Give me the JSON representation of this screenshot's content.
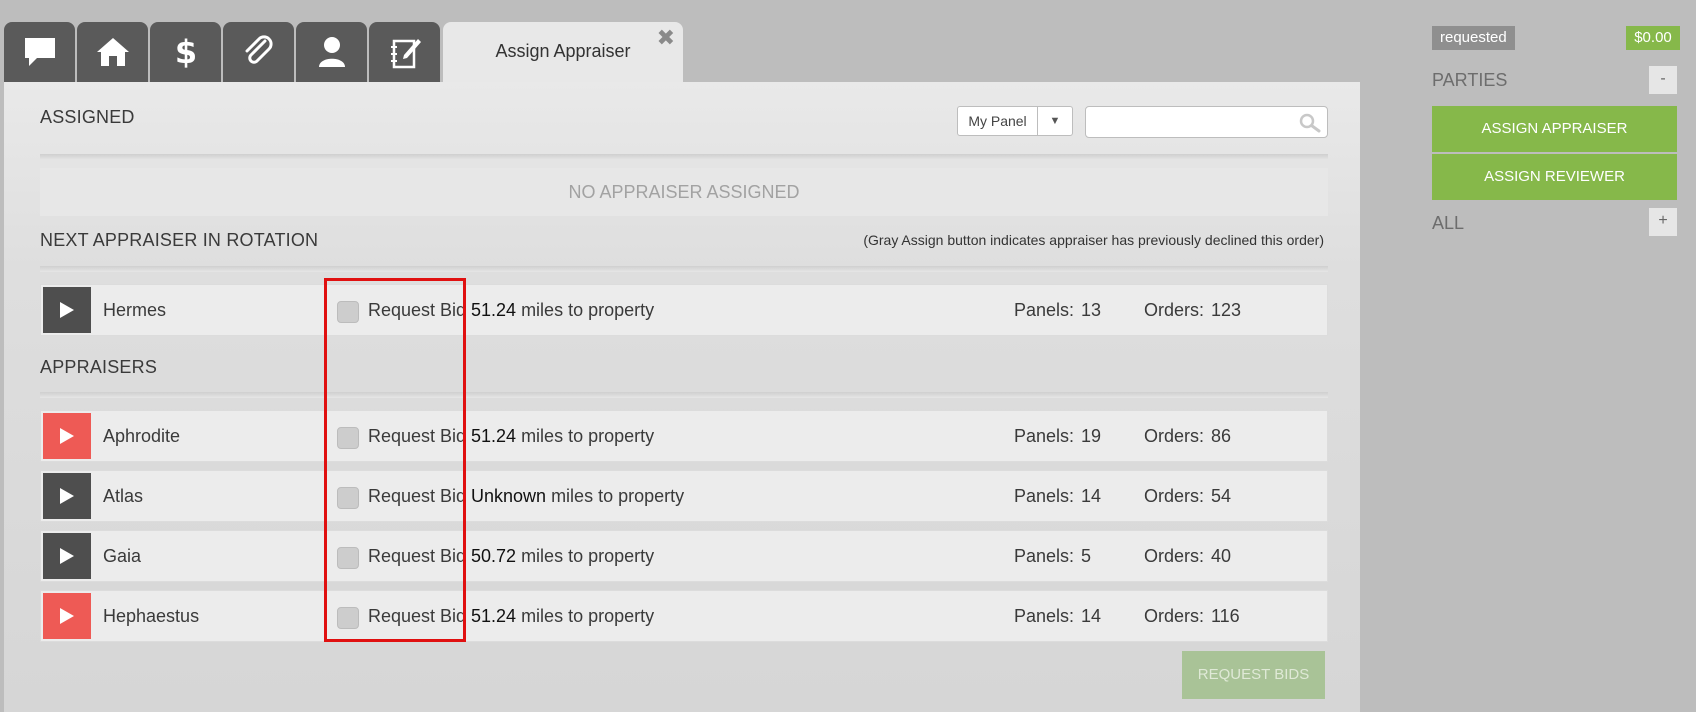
{
  "tabs": {
    "icons": [
      "chat-icon",
      "home-icon",
      "dollar-icon",
      "paperclip-icon",
      "user-icon",
      "notes-icon"
    ],
    "active_label": "Assign Appraiser",
    "close_glyph": "✖"
  },
  "assigned": {
    "title": "ASSIGNED",
    "panel_select": "My Panel",
    "search_placeholder": "",
    "empty_text": "NO APPRAISER ASSIGNED"
  },
  "rotation": {
    "title": "NEXT APPRAISER IN ROTATION",
    "note": "(Gray Assign button indicates appraiser has previously declined this order)",
    "row": {
      "name": "Hermes",
      "bid_label": "Request Bid",
      "distance": "51.24",
      "distance_suffix": "miles to property",
      "panels_label": "Panels:",
      "panels": "13",
      "orders_label": "Orders:",
      "orders": "123"
    }
  },
  "appraisers": {
    "title": "APPRAISERS",
    "rows": [
      {
        "name": "Aphrodite",
        "bid_label": "Request Bid",
        "distance": "51.24",
        "distance_suffix": "miles to property",
        "panels_label": "Panels:",
        "panels": "19",
        "orders_label": "Orders:",
        "orders": "86"
      },
      {
        "name": "Atlas",
        "bid_label": "Request Bid",
        "distance": "Unknown",
        "distance_suffix": "miles to property",
        "panels_label": "Panels:",
        "panels": "14",
        "orders_label": "Orders:",
        "orders": "54"
      },
      {
        "name": "Gaia",
        "bid_label": "Request Bid",
        "distance": "50.72",
        "distance_suffix": "miles to property",
        "panels_label": "Panels:",
        "panels": "5",
        "orders_label": "Orders:",
        "orders": "40"
      },
      {
        "name": "Hephaestus",
        "bid_label": "Request Bid",
        "distance": "51.24",
        "distance_suffix": "miles to property",
        "panels_label": "Panels:",
        "panels": "14",
        "orders_label": "Orders:",
        "orders": "116"
      }
    ],
    "request_bids_label": "REQUEST BIDS"
  },
  "sidebar": {
    "status": "requested",
    "amount": "$0.00",
    "parties_title": "PARTIES",
    "parties_toggle": "-",
    "assign_appraiser": "ASSIGN APPRAISER",
    "assign_reviewer": "ASSIGN REVIEWER",
    "all_title": "ALL",
    "all_toggle": "+"
  },
  "colors": {
    "accent_green": "#86b84a",
    "play_dark": "#4e4e4e",
    "play_red": "#ee5a55",
    "highlight_red": "#e01010"
  }
}
